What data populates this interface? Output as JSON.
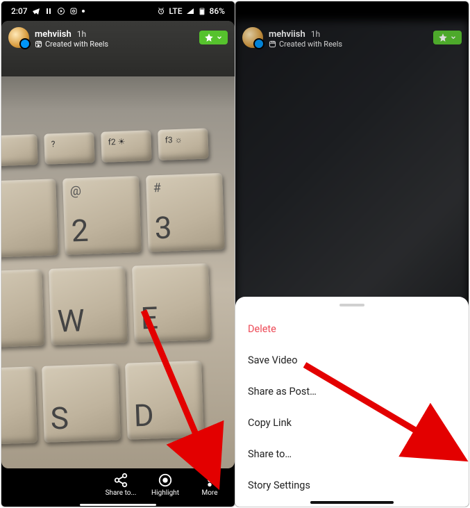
{
  "status": {
    "time": "2:07",
    "network": "LTE",
    "battery": "86%"
  },
  "story": {
    "username": "mehviish",
    "time": "1h",
    "created_with": "Created with Reels"
  },
  "actions": {
    "share": "Share to...",
    "highlight": "Highlight",
    "more": "More"
  },
  "sheet": {
    "delete": "Delete",
    "save": "Save Video",
    "share_post": "Share as Post…",
    "copy": "Copy Link",
    "share_to": "Share to…",
    "settings": "Story Settings"
  }
}
